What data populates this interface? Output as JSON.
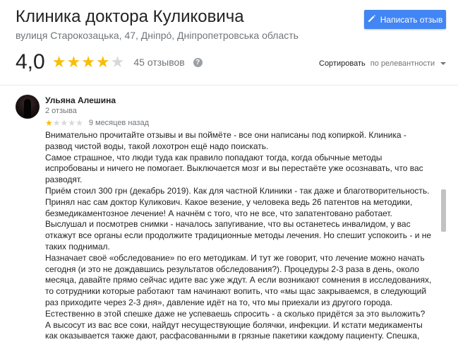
{
  "header": {
    "title": "Клиника доктора Куликовича",
    "address": "вулиця Старокозацька, 47, Дніпро́, Дніпропетровська область",
    "write_review_label": "Написать отзыв"
  },
  "summary": {
    "rating": "4,0",
    "rating_value": 4,
    "max_rating": 5,
    "review_count": "45 отзывов",
    "help_icon": "?"
  },
  "sort": {
    "label": "Сортировать",
    "value": "по релевантности"
  },
  "review": {
    "author": "Ульяна Алешина",
    "author_reviews": "2 отзыва",
    "rating_value": 1,
    "date": "9 месяцев назад",
    "paragraphs": [
      "Внимательно прочитайте отзывы и вы поймёте - все они написаны под копиркой. Клиника - развод чистой воды, такой лохотрон ещё надо поискать.",
      "Самое страшное, что люди туда как правило попадают тогда, когда обычные методы испробованы и ничего не помогает. Выключается мозг и вы перестаёте уже осознавать, что вас разводят.",
      "Приём стоил 300 грн (декабрь 2019). Как для частной Клиники - так даже и благотворительность. Принял нас сам доктор Куликович. Какое везение, у человека ведь 26 патентов на методики, безмедикаментозное лечение! А начнём с того, что не все, что запатентовано работает. Выслушал и посмотрев снимки - началось запугивание, что вы останетесь инвалидом, у вас откажут все органы если продолжите традиционные методы лечения. Но спешит успокоить - и не таких поднимал.",
      "Назначает своё «обследование» по его методикам. И тут же говорит, что лечение можно начать сегодня (и это не дождавшись результатов обследования?). Процедуры 2-3 раза в день, около месяца, давайте прямо сейчас идите вас уже ждут. А если возникают сомнения в исследованиях, то сотрудники которые работают там начинают вопить, что «мы щас закрываемся, в следующий раз приходите через 2-3 дня», давление идёт на то, что мы приехали из другого города. Естественно в этой спешке даже не успеваешь спросить - а сколько придётся за это выложить? А высосут из вас все соки, найдут несуществующие болячки, инфекции. И кстати медикаменты как оказывается также дают, расфасованными в грязные пакетики каждому пациенту. Спешка,"
    ]
  },
  "colors": {
    "accent": "#4285f4",
    "star": "#fbbc04",
    "star_empty": "#d8d8d8",
    "secondary_text": "#70757a"
  },
  "icons": {
    "write": "pencil-icon",
    "help": "help-icon",
    "sort_caret": "caret-down-icon"
  }
}
